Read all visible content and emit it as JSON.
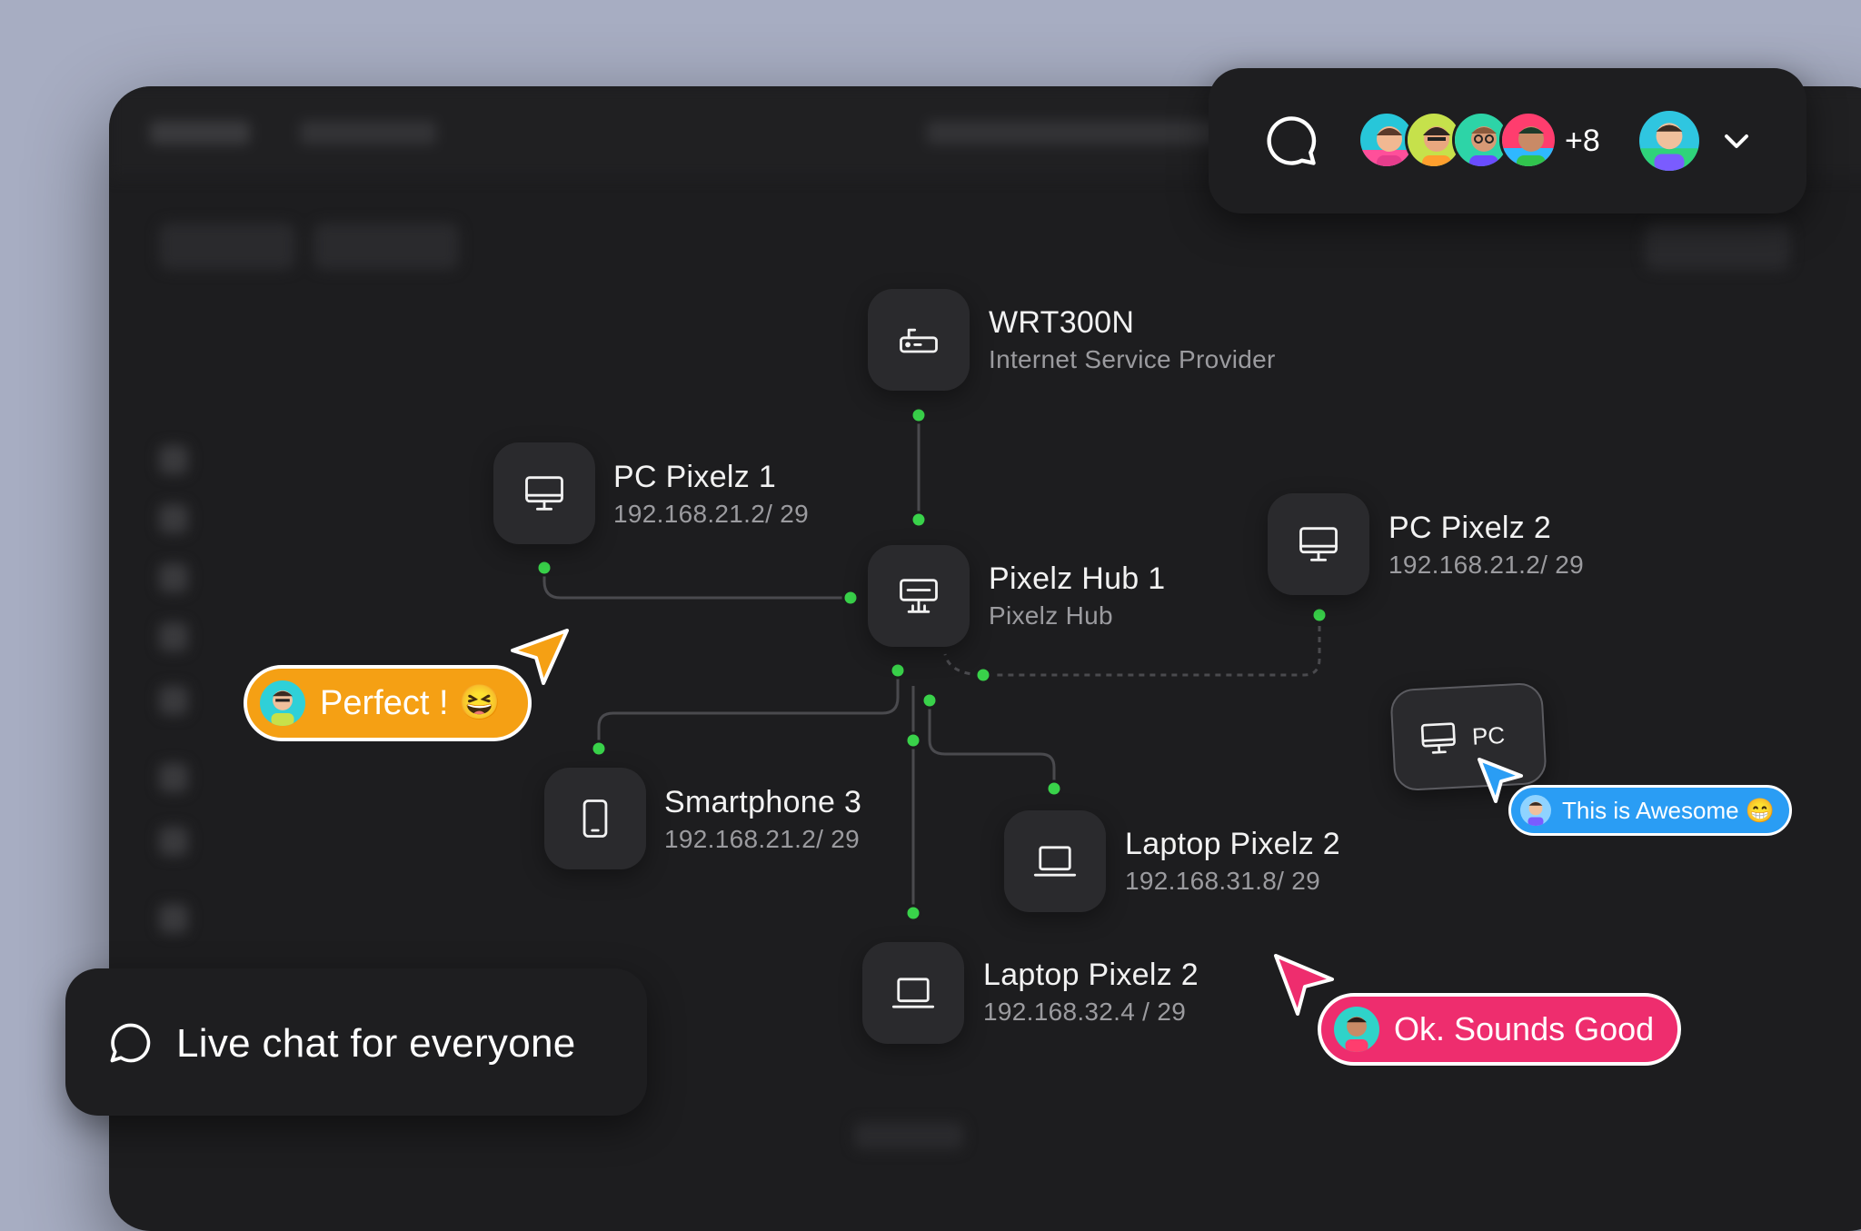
{
  "nodes": {
    "wrt": {
      "title": "WRT300N",
      "sub": "Internet Service Provider",
      "icon": "router-icon"
    },
    "pc1": {
      "title": "PC Pixelz 1",
      "sub": "192.168.21.2/ 29",
      "icon": "monitor-icon"
    },
    "hub": {
      "title": "Pixelz Hub 1",
      "sub": "Pixelz Hub",
      "icon": "hub-icon"
    },
    "pc2": {
      "title": "PC Pixelz 2",
      "sub": "192.168.21.2/ 29",
      "icon": "monitor-icon"
    },
    "phone": {
      "title": "Smartphone 3",
      "sub": "192.168.21.2/ 29",
      "icon": "smartphone-icon"
    },
    "laptop_a": {
      "title": "Laptop Pixelz 2",
      "sub": "192.168.31.8/ 29",
      "icon": "laptop-icon"
    },
    "laptop_b": {
      "title": "Laptop Pixelz 2",
      "sub": "192.168.32.4 / 29",
      "icon": "laptop-icon"
    }
  },
  "collab": {
    "extra_count": "+8"
  },
  "pc_card": {
    "label": "PC"
  },
  "messages": {
    "perfect": "Perfect ! 😆",
    "awesome": "This is Awesome 😁",
    "sounds_good": "Ok. Sounds Good"
  },
  "promo": {
    "live_chat": "Live chat for everyone"
  },
  "colors": {
    "accent_green": "#39d24a",
    "orange": "#f5a014",
    "blue": "#2a9df4",
    "pink": "#ee2d6e",
    "panel": "#1e1e20",
    "node": "#2a2a2d"
  }
}
